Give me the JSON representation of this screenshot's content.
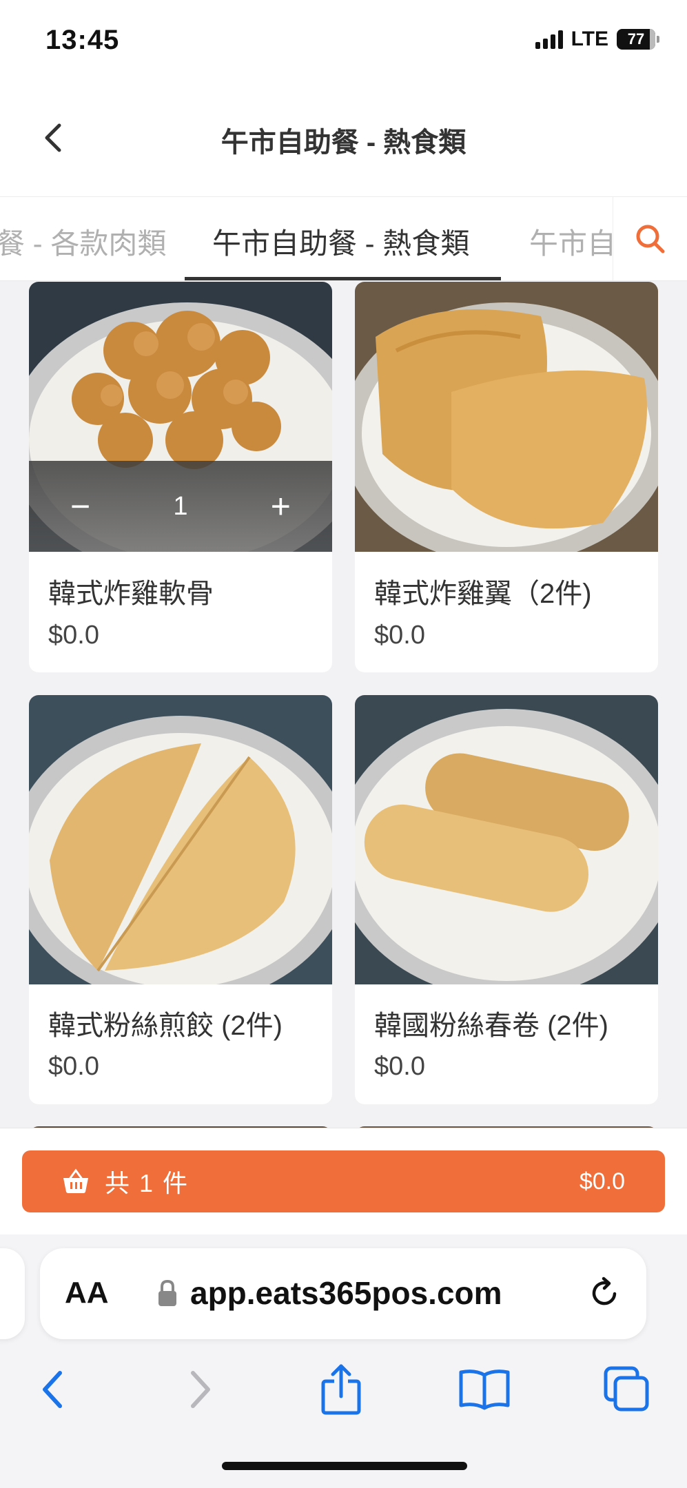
{
  "status_bar": {
    "time": "13:45",
    "network": "LTE",
    "battery": "77"
  },
  "header": {
    "title": "午市自助餐 - 熱食類"
  },
  "tabs": [
    {
      "label": "餐 - 各款肉類",
      "active": false
    },
    {
      "label": "午市自助餐 - 熱食類",
      "active": true
    },
    {
      "label": "午市自",
      "active": false
    }
  ],
  "products": [
    {
      "name": "韓式炸雞軟骨",
      "price": "$0.0",
      "quantity": "1"
    },
    {
      "name": "韓式炸雞翼（2件)",
      "price": "$0.0"
    },
    {
      "name": "韓式粉絲煎餃 (2件)",
      "price": "$0.0"
    },
    {
      "name": "韓國粉絲春卷 (2件)",
      "price": "$0.0"
    }
  ],
  "cart": {
    "label": "共 1 件",
    "total": "$0.0"
  },
  "browser": {
    "text_size_label": "AA",
    "url": "app.eats365pos.com"
  },
  "colors": {
    "accent": "#ef6e3a",
    "browser_blue": "#1a73e8"
  }
}
